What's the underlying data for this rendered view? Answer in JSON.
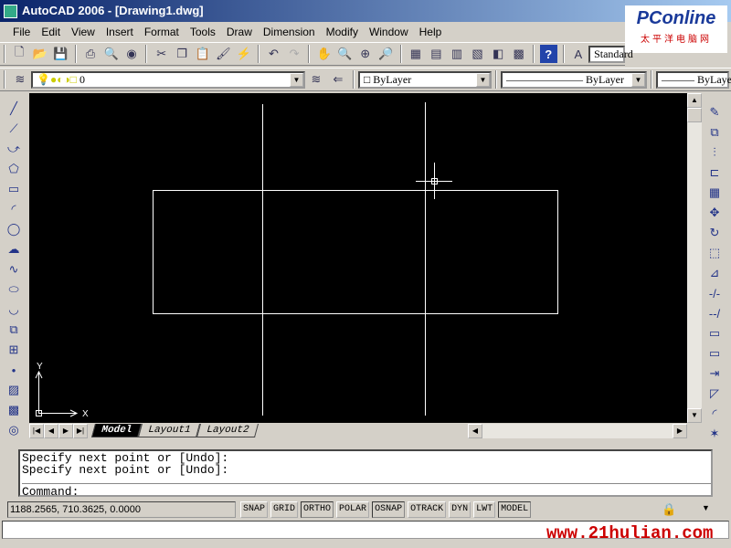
{
  "window": {
    "title": "AutoCAD 2006 - [Drawing1.dwg]"
  },
  "logo": {
    "name": "PConline",
    "sub": "太平洋电脑网"
  },
  "menu": [
    "File",
    "Edit",
    "View",
    "Insert",
    "Format",
    "Tools",
    "Draw",
    "Dimension",
    "Modify",
    "Window",
    "Help"
  ],
  "toolbar": {
    "text_style": "Standard"
  },
  "layers": {
    "current_layer": "0",
    "color": "ByLayer",
    "linetype": "ByLayer",
    "lineweight": "ByLayer"
  },
  "tabs": [
    "Model",
    "Layout1",
    "Layout2"
  ],
  "ucs": {
    "x": "X",
    "y": "Y"
  },
  "command": {
    "history": [
      "Specify next point or [Undo]:",
      "Specify next point or [Undo]:"
    ],
    "prompt": "Command:"
  },
  "status": {
    "coords": "1188.2565, 710.3625, 0.0000",
    "toggles": [
      {
        "label": "SNAP",
        "on": false
      },
      {
        "label": "GRID",
        "on": false
      },
      {
        "label": "ORTHO",
        "on": true
      },
      {
        "label": "POLAR",
        "on": false
      },
      {
        "label": "OSNAP",
        "on": true
      },
      {
        "label": "OTRACK",
        "on": false
      },
      {
        "label": "DYN",
        "on": false
      },
      {
        "label": "LWT",
        "on": false
      },
      {
        "label": "MODEL",
        "on": true
      }
    ]
  },
  "watermark": "www.21hulian.com"
}
